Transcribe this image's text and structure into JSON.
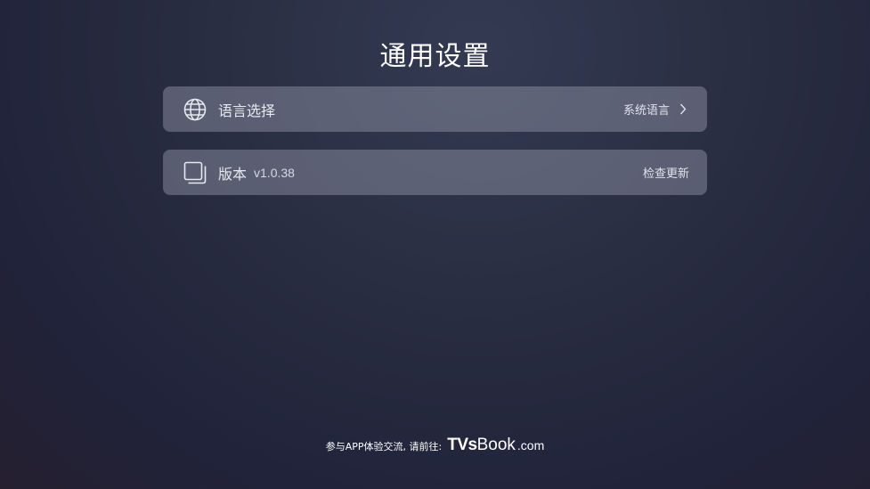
{
  "header": {
    "title": "通用设置"
  },
  "settings": {
    "language": {
      "icon": "globe-icon",
      "label": "语言选择",
      "value": "系统语言"
    },
    "version": {
      "icon": "layers-icon",
      "label": "版本",
      "version_text": "v1.0.38",
      "action": "检查更新"
    }
  },
  "footer": {
    "text": "参与APP体验交流, 请前往:",
    "brand_part1": "TVs",
    "brand_part2": "Book",
    "brand_part3": ".com"
  },
  "colors": {
    "row_background": "#6b6e80",
    "text_primary": "#ffffff",
    "text_secondary": "#e6e8ee"
  }
}
